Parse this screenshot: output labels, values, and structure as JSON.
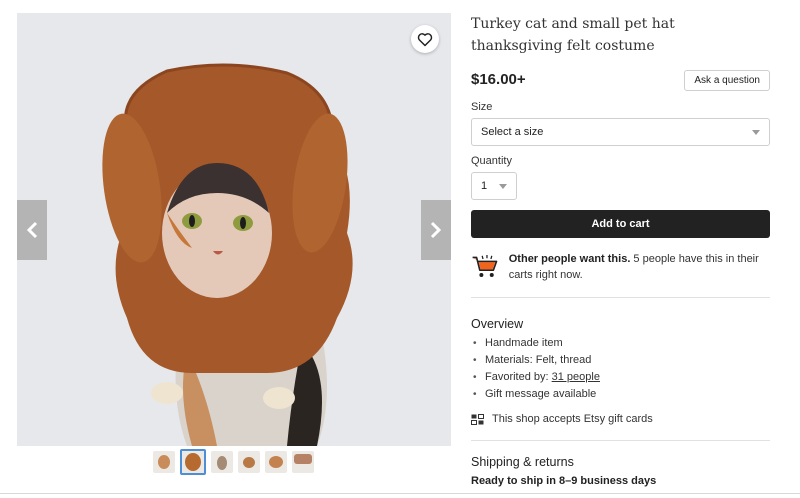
{
  "listing": {
    "title": "Turkey cat and small pet hat thanksgiving felt costume",
    "price": "$16.00+",
    "ask_label": "Ask a question"
  },
  "size": {
    "label": "Size",
    "selected": "Select a size"
  },
  "quantity": {
    "label": "Quantity",
    "selected": "1"
  },
  "cart": {
    "button_label": "Add to cart"
  },
  "demand": {
    "bold": "Other people want this.",
    "rest": " 5 people have this in their carts right now."
  },
  "overview": {
    "heading": "Overview",
    "items": [
      "Handmade item",
      "Materials: Felt, thread"
    ],
    "favorited_prefix": "Favorited by: ",
    "favorited_link": "31 people",
    "gift_item": "Gift message available",
    "gift_cards": "This shop accepts Etsy gift cards"
  },
  "shipping": {
    "heading": "Shipping & returns",
    "subheading": "Ready to ship in 8–9 business days"
  },
  "gallery": {
    "thumbnail_count": 6,
    "active_thumbnail": 2,
    "icons": [
      "heart-icon",
      "chevron-left-icon",
      "chevron-right-icon",
      "cart-icon",
      "gift-card-icon"
    ]
  },
  "colors": {
    "accent_dark": "#222222",
    "cart_icon_orange": "#f1641e",
    "thumb_active_border": "#4d8fd6"
  }
}
